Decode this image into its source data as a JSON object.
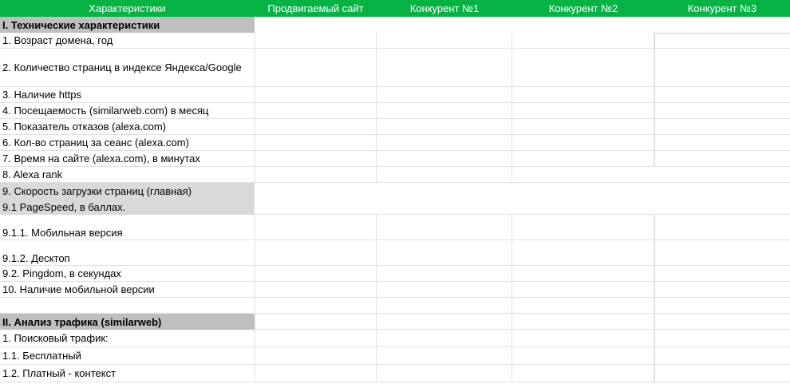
{
  "header": {
    "columns": [
      "Характеристики",
      "Продвигаемый сайт",
      "Конкурент №1",
      "Конкурент №2",
      "Конкурент №3"
    ]
  },
  "rows": [
    {
      "label": "I. Технические характеристики",
      "style": "section"
    },
    {
      "label": "1. Возраст домена, год",
      "style": "normal"
    },
    {
      "label": "2. Количество страниц в индексе Яндекса/Google",
      "style": "normal"
    },
    {
      "label": "3. Наличие https",
      "style": "normal"
    },
    {
      "label": "4. Посещаемость (similarweb.com) в месяц",
      "style": "normal"
    },
    {
      "label": "5. Показатель отказов (alexa.com)",
      "style": "normal"
    },
    {
      "label": "6. Кол-во страниц за сеанс (alexa.com)",
      "style": "normal"
    },
    {
      "label": "7. Время на сайте (alexa.com), в минутах",
      "style": "normal"
    },
    {
      "label": "8. Alexa rank",
      "style": "normal"
    },
    {
      "label": "9. Скорость загрузки страниц (главная)",
      "style": "light"
    },
    {
      "label": "9.1 PageSpeed, в баллах.",
      "style": "light"
    },
    {
      "label": "9.1.1. Мобильная версия",
      "style": "normal"
    },
    {
      "label": "9.1.2. Десктоп",
      "style": "normal"
    },
    {
      "label": "9.2. Pingdom, в секундах",
      "style": "normal"
    },
    {
      "label": "10. Наличие мобильной версии",
      "style": "normal"
    },
    {
      "label": "",
      "style": "normal"
    },
    {
      "label": "II. Анализ трафика (similarweb)",
      "style": "section"
    },
    {
      "label": "1. Поисковый трафик:",
      "style": "normal"
    },
    {
      "label": "1.1. Бесплатный",
      "style": "normal"
    },
    {
      "label": "1.2. Платный - контекст",
      "style": "normal"
    }
  ],
  "colors": {
    "header_bg": "#07b245",
    "section_bg": "#bfbfbf",
    "light_bg": "#d9d9d9",
    "grid_line": "#e1e1e1"
  }
}
